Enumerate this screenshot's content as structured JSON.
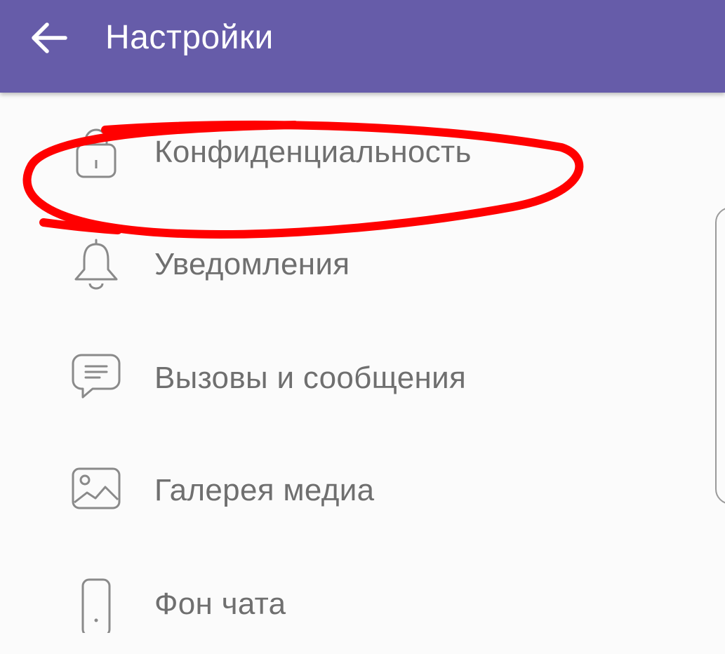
{
  "header": {
    "title": "Настройки",
    "back_icon": "arrow-left-icon",
    "background_color": "#665ca9"
  },
  "settings": {
    "items": [
      {
        "label": "Конфиденциальность",
        "icon": "lock-icon"
      },
      {
        "label": "Уведомления",
        "icon": "bell-icon"
      },
      {
        "label": "Вызовы и сообщения",
        "icon": "chat-bubble-icon"
      },
      {
        "label": "Галерея медиа",
        "icon": "image-gallery-icon"
      },
      {
        "label": "Фон чата",
        "icon": "phone-icon"
      }
    ]
  },
  "annotation": {
    "color": "#ff0000",
    "shape": "hand-drawn ellipse around Конфиденциальность"
  }
}
